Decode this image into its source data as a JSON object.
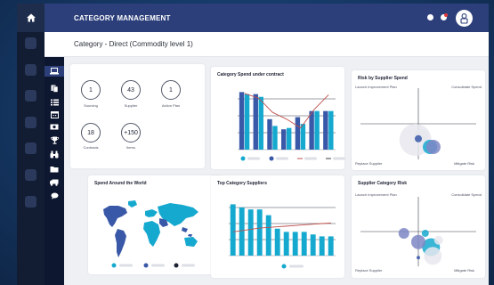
{
  "app": {
    "title": "CATEGORY MANAGEMENT"
  },
  "page": {
    "title": "Category - Direct (Commodity level 1)"
  },
  "colors": {
    "topbar": "#2c3f7a",
    "rail": "#121c33",
    "cyan": "#16a9cf",
    "navy": "#3a58a8",
    "trend": "#c0504d",
    "notify_red": "#e23b3b"
  },
  "sidebar": {
    "icons": [
      "laptop-icon",
      "documents-icon",
      "list-icon",
      "calendar-icon",
      "money-icon",
      "trophy-icon",
      "binoculars-icon",
      "folder-icon",
      "truck-icon",
      "chat-icon"
    ]
  },
  "metrics": [
    {
      "value": "1",
      "label": "Sourcing"
    },
    {
      "value": "43",
      "label": "Supplier"
    },
    {
      "value": "1",
      "label": "Action Plan"
    },
    {
      "value": "18",
      "label": "Contracts"
    },
    {
      "value": "+150",
      "label": "Items"
    }
  ],
  "cards": {
    "spend_contract": {
      "title": "Category Spend under contract"
    },
    "risk_spend": {
      "title": "Risk by Supplier Spend",
      "quadrants": {
        "top_left": "Launch Improvement Plan",
        "top_right": "Consolidate Spend",
        "bottom_left": "Replace Supplier",
        "bottom_right": "Mitigate Risk"
      }
    },
    "spend_world": {
      "title": "Spend Around the World"
    },
    "top_suppliers": {
      "title": "Top Category Suppliers"
    },
    "supplier_risk": {
      "title": "Supplier Category Risk",
      "quadrants": {
        "top_left": "Launch Improvement Plan",
        "top_right": "Consolidate Spend",
        "bottom_left": "Replace Supplier",
        "bottom_right": "Mitigate Risk"
      }
    }
  },
  "chart_data": [
    {
      "type": "bar",
      "title": "Category Spend under contract",
      "categories": [
        "1",
        "2",
        "3",
        "4",
        "5",
        "6",
        "7"
      ],
      "ylim": [
        0,
        10
      ],
      "series": [
        {
          "values": [
            8.5,
            8.2,
            4.5,
            3.0,
            4.8,
            5.7,
            5.7
          ],
          "color": "#3a58a8"
        },
        {
          "values": [
            8.2,
            7.8,
            3.5,
            3.2,
            3.8,
            5.7,
            5.7
          ],
          "color": "#16a9cf"
        },
        {
          "values": [
            8.3,
            7.6,
            5.5,
            4.5,
            3.2,
            6.0,
            8.1
          ],
          "color": "#c0504d",
          "line": true
        }
      ],
      "grid": true
    },
    {
      "type": "bar",
      "title": "Top Category Suppliers",
      "categories": [
        "1",
        "2",
        "3",
        "4",
        "5",
        "6",
        "7",
        "8",
        "9",
        "10",
        "11",
        "12"
      ],
      "ylim": [
        0,
        10
      ],
      "series": [
        {
          "values": [
            8.0,
            7.5,
            7.2,
            7.2,
            6.3,
            4.2,
            3.7,
            3.7,
            3.7,
            3.3,
            3.0,
            3.0
          ],
          "color": "#16a9cf"
        },
        {
          "values": [
            3.7,
            3.9,
            4.1,
            4.3,
            4.4,
            4.5,
            4.6,
            4.7,
            4.8,
            4.9,
            5.0,
            5.1
          ],
          "color": "#c0504d",
          "line": true
        }
      ],
      "grid": true
    },
    {
      "type": "scatter",
      "title": "Risk by Supplier Spend",
      "xlim": [
        -1,
        1
      ],
      "ylim": [
        -1,
        1
      ],
      "series": [
        {
          "points": [
            [
              -0.05,
              -0.45,
              18
            ],
            [
              0.05,
              -0.35,
              8
            ]
          ],
          "color": "#e7e7ee"
        },
        {
          "points": [
            [
              0.2,
              -0.65,
              8
            ]
          ],
          "color": "#16a9cf"
        },
        {
          "points": [
            [
              0.26,
              -0.65,
              8
            ]
          ],
          "color": "#7d86c4"
        },
        {
          "points": [
            [
              0.0,
              -0.42,
              4
            ]
          ],
          "color": "#3a58a8"
        }
      ]
    },
    {
      "type": "scatter",
      "title": "Supplier Category Risk",
      "xlim": [
        -1,
        1
      ],
      "ylim": [
        -1,
        1
      ],
      "series": [
        {
          "points": [
            [
              0.22,
              -0.45,
              10
            ],
            [
              0.12,
              -0.05,
              4
            ]
          ],
          "color": "#16a9cf"
        },
        {
          "points": [
            [
              -0.25,
              -0.05,
              6
            ],
            [
              0.0,
              -0.3,
              8
            ]
          ],
          "color": "#7d86c4"
        },
        {
          "points": [
            [
              0.25,
              -0.7,
              10
            ],
            [
              0.35,
              -0.25,
              5
            ]
          ],
          "color": "#e7e7ee"
        },
        {
          "points": [
            [
              0.0,
              -0.75,
              2
            ]
          ],
          "color": "#3a58a8"
        }
      ]
    }
  ]
}
